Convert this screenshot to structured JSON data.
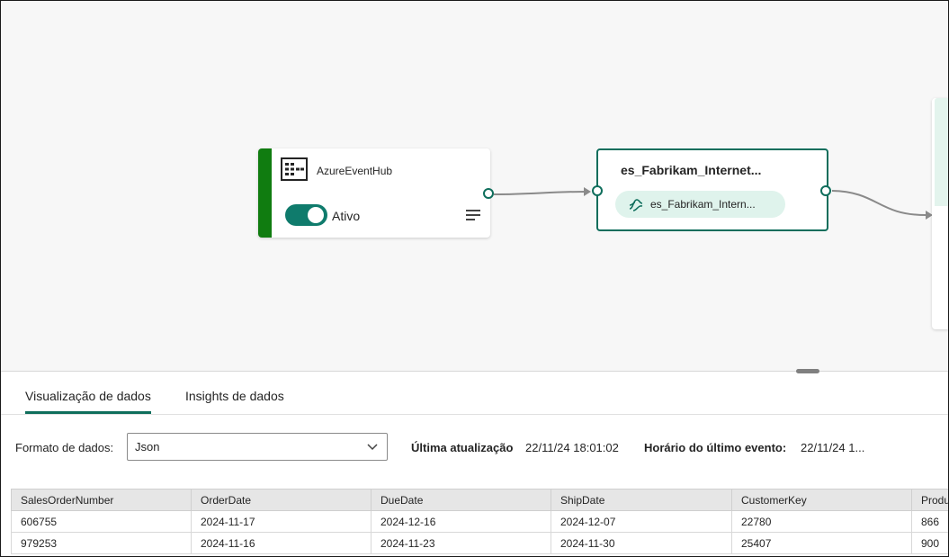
{
  "canvas": {
    "source_node": {
      "title": "AzureEventHub",
      "icon": "event-hub-icon",
      "toggle_label": "Ativo",
      "toggle_on": true,
      "menu_icon": "hamburger-menu-icon",
      "accent_color": "#107c10"
    },
    "stream_node": {
      "title": "es_Fabrikam_Internet...",
      "chip_label": "es_Fabrikam_Intern...",
      "chip_icon": "eventstream-icon",
      "border_color": "#0f6e5c"
    }
  },
  "tabs": [
    {
      "label": "Visualização de dados",
      "active": true
    },
    {
      "label": "Insights de dados",
      "active": false
    }
  ],
  "toolbar": {
    "format_label": "Formato de dados:",
    "format_value": "Json",
    "last_update_label": "Última atualização",
    "last_update_value": "22/11/24 18:01:02",
    "last_event_label": "Horário do último evento:",
    "last_event_value": "22/11/24 1..."
  },
  "table": {
    "columns": [
      "SalesOrderNumber",
      "OrderDate",
      "DueDate",
      "ShipDate",
      "CustomerKey",
      "Produ"
    ],
    "rows": [
      [
        "606755",
        "2024-11-17",
        "2024-12-16",
        "2024-12-07",
        "22780",
        "866"
      ],
      [
        "979253",
        "2024-11-16",
        "2024-11-23",
        "2024-11-30",
        "25407",
        "900"
      ]
    ]
  }
}
